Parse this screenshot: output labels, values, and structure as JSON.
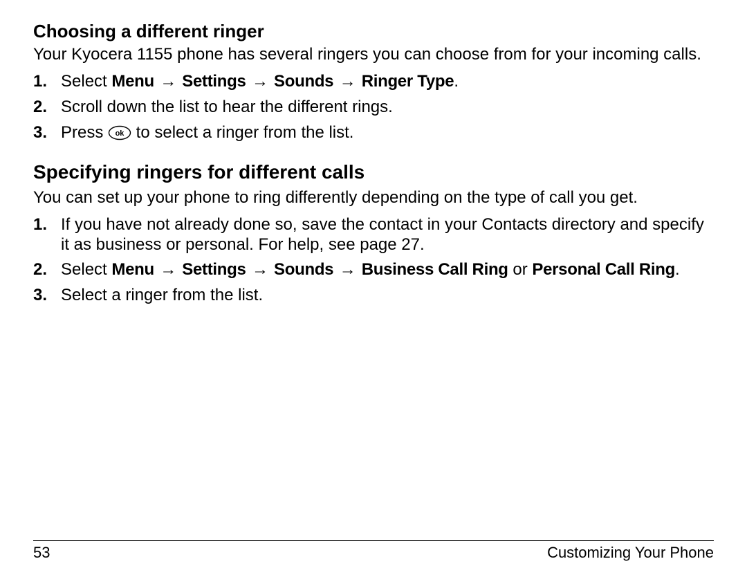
{
  "section1": {
    "heading": "Choosing a different ringer",
    "intro": "Your Kyocera 1155 phone has several ringers you can choose from for your incoming calls.",
    "steps": {
      "s1_a": "Select ",
      "s1_nav_menu": "Menu",
      "s1_nav_settings": "Settings",
      "s1_nav_sounds": "Sounds",
      "s1_nav_ringer": "Ringer Type",
      "s1_z": ".",
      "s2": "Scroll down the list to hear the different rings.",
      "s3_a": "Press ",
      "s3_b": " to select a ringer from the list."
    }
  },
  "section2": {
    "heading": "Specifying ringers for different calls",
    "intro": "You can set up your phone to ring differently depending on the type of call you get.",
    "steps": {
      "s1": "If you have not already done so, save the contact in your Contacts directory and specify it as business or personal. For help, see page 27.",
      "s2_a": "Select ",
      "s2_nav_menu": "Menu",
      "s2_nav_settings": "Settings",
      "s2_nav_sounds": "Sounds",
      "s2_nav_bus": "Business Call Ring",
      "s2_or": " or ",
      "s2_nav_per": "Personal Call Ring",
      "s2_z": ".",
      "s3": "Select a ringer from the list."
    }
  },
  "footer": {
    "page": "53",
    "title": "Customizing Your Phone"
  },
  "glyphs": {
    "arrow": "→",
    "ok": "ok"
  }
}
